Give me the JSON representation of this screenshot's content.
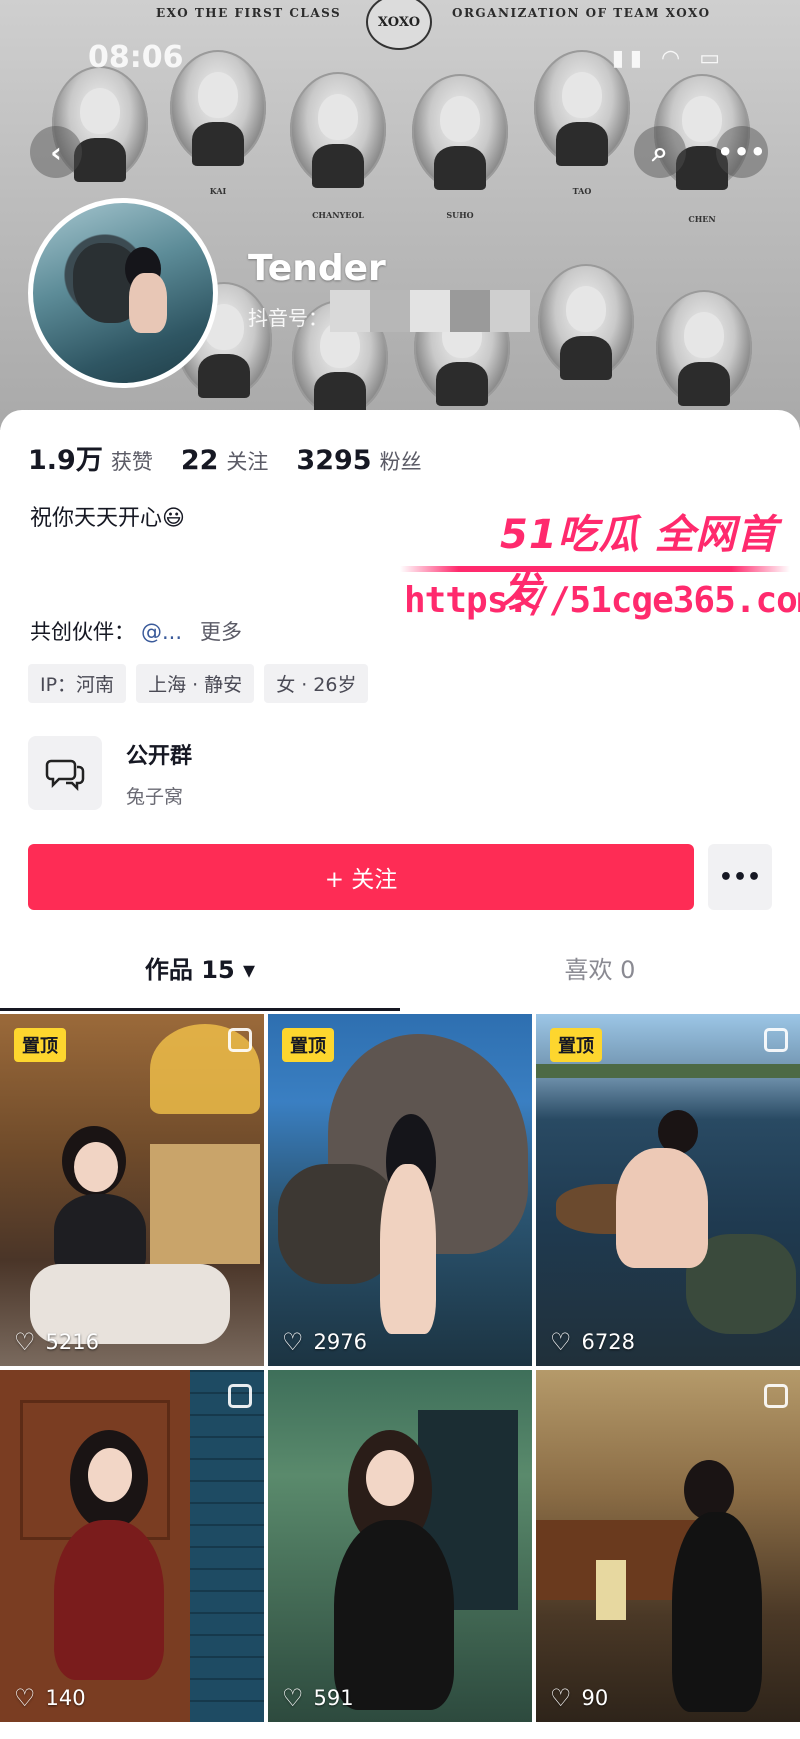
{
  "status_bar": {
    "time": "08:06",
    "icons": "▮▮ ◠ ▭"
  },
  "banner": {
    "caption_left": "EXO THE FIRST CLASS",
    "caption_right": "ORGANIZATION OF TEAM XOXO",
    "crest": "XOXO",
    "portrait_names": [
      "KAI",
      "CHANYEOL",
      "SUHO",
      "TAO",
      "CHEN"
    ]
  },
  "nav": {
    "back_icon": "‹",
    "search_icon": "⌕",
    "more_icon": "•••"
  },
  "profile": {
    "name": "Tender",
    "douyin_id_label": "抖音号："
  },
  "stats": [
    {
      "value": "1.9万",
      "label": "获赞"
    },
    {
      "value": "22",
      "label": "关注"
    },
    {
      "value": "3295",
      "label": "粉丝"
    }
  ],
  "bio": "祝你天天开心😃",
  "watermark": {
    "title": "51吃瓜 全网首发",
    "url": "https://51cge365.com"
  },
  "cocreate": {
    "label": "共创伙伴：",
    "link": "@...",
    "more": "更多"
  },
  "tags": [
    "IP：河南",
    "上海 · 静安",
    "女 · 26岁"
  ],
  "group": {
    "icon": "💬",
    "title": "公开群",
    "subtitle": "兔子窝"
  },
  "actions": {
    "follow": "+ 关注",
    "more": "•••"
  },
  "tabs": [
    {
      "label": "作品 15 ▾",
      "active": true
    },
    {
      "label": "喜欢 0",
      "active": false
    }
  ],
  "posts": [
    {
      "pinned": "置顶",
      "likes": "5216"
    },
    {
      "pinned": "置顶",
      "likes": "2976"
    },
    {
      "pinned": "置顶",
      "likes": "6728"
    },
    {
      "pinned": "",
      "likes": "140"
    },
    {
      "pinned": "",
      "likes": "591"
    },
    {
      "pinned": "",
      "likes": "90"
    }
  ],
  "colors": {
    "accent": "#fe2c55",
    "pin": "#fdd62e",
    "watermark": "#ff2a6d"
  }
}
